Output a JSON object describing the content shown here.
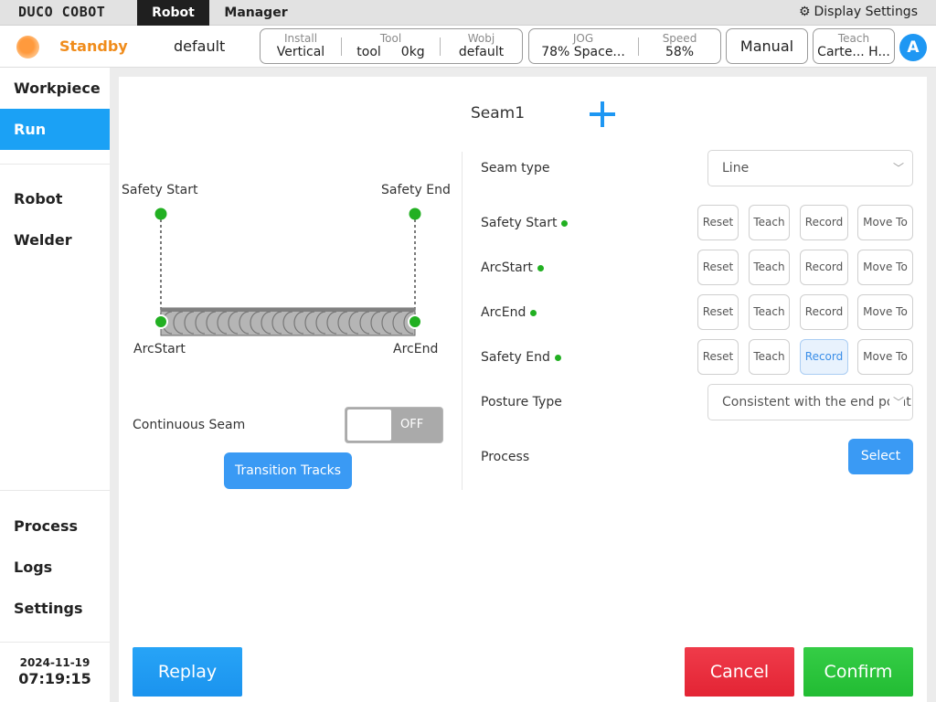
{
  "topbar": {
    "logo": "DUCO COBOT",
    "tabs": [
      "Robot",
      "Manager"
    ],
    "display_settings": "Display Settings"
  },
  "status": {
    "state": "Standby",
    "project": "default",
    "install": {
      "label": "Install",
      "value": "Vertical"
    },
    "tool": {
      "label": "Tool",
      "name": "tool",
      "weight": "0kg"
    },
    "wobj": {
      "label": "Wobj",
      "value": "default"
    },
    "jog": {
      "label": "JOG",
      "value": "78%  Space..."
    },
    "speed": {
      "label": "Speed",
      "value": "58%"
    },
    "mode": "Manual",
    "teach": {
      "label": "Teach",
      "value": "Carte... H..."
    },
    "avatar": "A"
  },
  "sidebar": {
    "items": [
      "Workpiece",
      "Run",
      "Robot",
      "Welder",
      "Process",
      "Logs",
      "Settings"
    ],
    "active": "Run",
    "date": "2024-11-19",
    "time": "07:19:15"
  },
  "seam": {
    "title": "Seam1",
    "diagram": {
      "safety_start": "Safety Start",
      "safety_end": "Safety End",
      "arc_start": "ArcStart",
      "arc_end": "ArcEnd"
    },
    "continuous_seam": {
      "label": "Continuous Seam",
      "state": "OFF"
    },
    "transition_tracks": "Transition Tracks",
    "seam_type": {
      "label": "Seam type",
      "value": "Line"
    },
    "points": [
      {
        "label": "Safety Start",
        "status_color": "#22b022"
      },
      {
        "label": "ArcStart",
        "status_color": "#22b022"
      },
      {
        "label": "ArcEnd",
        "status_color": "#22b022"
      },
      {
        "label": "Safety End",
        "status_color": "#22b022"
      }
    ],
    "point_actions": [
      "Reset",
      "Teach",
      "Record",
      "Move To"
    ],
    "posture_type": {
      "label": "Posture Type",
      "value": "Consistent with the end point"
    },
    "process": {
      "label": "Process",
      "button": "Select"
    }
  },
  "footer": {
    "replay": "Replay",
    "cancel": "Cancel",
    "confirm": "Confirm"
  },
  "colors": {
    "accent": "#1ba1f5",
    "standby": "#f08c1b",
    "cancel": "#e32434",
    "confirm": "#22bc33",
    "point_dot": "#22b022"
  }
}
